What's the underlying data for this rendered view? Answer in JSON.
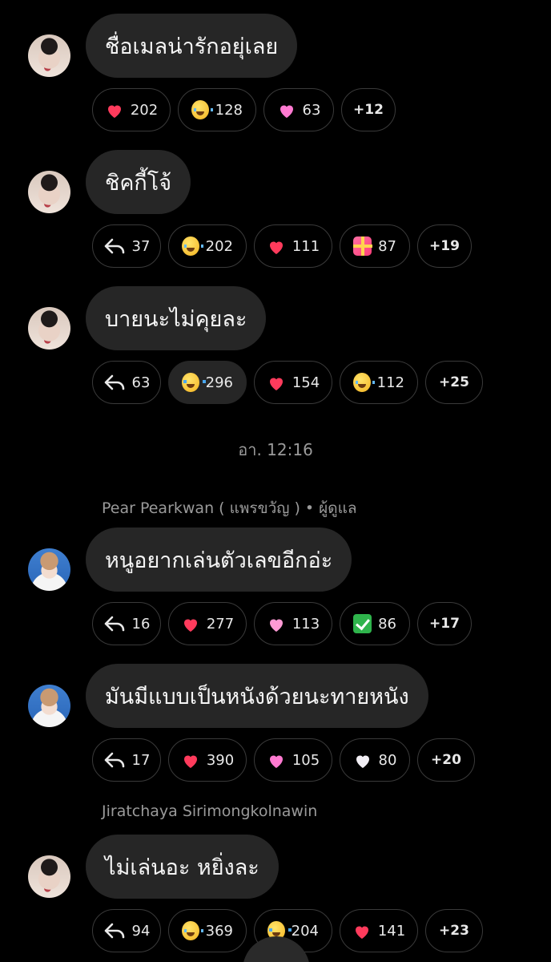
{
  "messages": [
    {
      "text": "ชื่อเมลน่ารักอยุ่เลย",
      "reactions": [
        {
          "icon": "red-heart-icon",
          "count": "202"
        },
        {
          "icon": "grinning-squint-face-icon",
          "count": "128"
        },
        {
          "icon": "pink-heart-icon",
          "count": "63"
        },
        {
          "count": "+12"
        }
      ]
    },
    {
      "text": "ชิคกี้โจ้",
      "reactions": [
        {
          "icon": "reply-icon",
          "count": "37"
        },
        {
          "icon": "tears-of-joy-face-icon",
          "count": "202"
        },
        {
          "icon": "red-heart-icon",
          "count": "111"
        },
        {
          "icon": "heart-with-ribbon-icon",
          "count": "87"
        },
        {
          "count": "+19"
        }
      ]
    },
    {
      "text": "บายนะไม่คุยละ",
      "reactions": [
        {
          "icon": "reply-icon",
          "count": "63"
        },
        {
          "icon": "crying-face-icon",
          "count": "296"
        },
        {
          "icon": "red-heart-icon",
          "count": "154"
        },
        {
          "icon": "tears-of-joy-face-icon",
          "count": "112"
        },
        {
          "count": "+25"
        }
      ]
    },
    {
      "text": "หนูอยากเล่นตัวเลขอีกอ่ะ",
      "reactions": [
        {
          "icon": "reply-icon",
          "count": "16"
        },
        {
          "icon": "red-heart-icon",
          "count": "277"
        },
        {
          "icon": "pink-heart-icon",
          "count": "113"
        },
        {
          "icon": "check-mark-button-icon",
          "count": "86"
        },
        {
          "count": "+17"
        }
      ]
    },
    {
      "text": "มันมีแบบเป็นหนังด้วยนะทายหนัง",
      "reactions": [
        {
          "icon": "reply-icon",
          "count": "17"
        },
        {
          "icon": "red-heart-icon",
          "count": "390"
        },
        {
          "icon": "pink-heart-icon",
          "count": "105"
        },
        {
          "icon": "white-heart-icon",
          "count": "80"
        },
        {
          "count": "+20"
        }
      ]
    },
    {
      "text": "ไม่เล่นอะ หยิ่งละ",
      "reactions": [
        {
          "icon": "reply-icon",
          "count": "94"
        },
        {
          "icon": "tears-of-joy-face-icon",
          "count": "369"
        },
        {
          "icon": "crying-face-icon",
          "count": "204"
        },
        {
          "icon": "red-heart-icon",
          "count": "141"
        },
        {
          "count": "+23"
        }
      ]
    }
  ],
  "timestamp": "อา. 12:16",
  "sender_admin": "Pear Pearkwan ( แพรขวัญ ) • ผู้ดูแล",
  "sender_2": "Jiratchaya Sirimongkolnawin",
  "colors": {
    "background": "#000000",
    "bubble": "#262626",
    "pill_border": "#3a3a3a",
    "muted_text": "#9a9a9a"
  }
}
